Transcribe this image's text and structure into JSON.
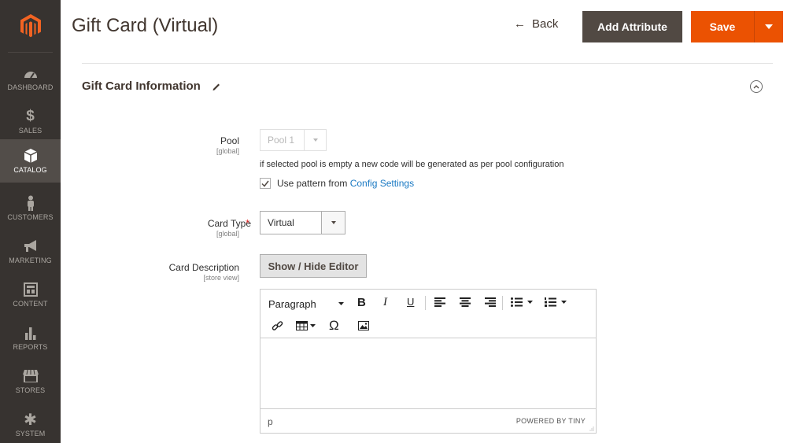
{
  "page": {
    "title": "Gift Card (Virtual)",
    "back_label": "Back",
    "add_attribute_label": "Add Attribute",
    "save_label": "Save"
  },
  "sidebar": {
    "items": [
      {
        "label": "DASHBOARD",
        "icon": "dashboard-icon"
      },
      {
        "label": "SALES",
        "icon": "dollar-icon"
      },
      {
        "label": "CATALOG",
        "icon": "box-icon",
        "active": true
      },
      {
        "label": "CUSTOMERS",
        "icon": "person-icon"
      },
      {
        "label": "MARKETING",
        "icon": "megaphone-icon"
      },
      {
        "label": "CONTENT",
        "icon": "layout-icon"
      },
      {
        "label": "REPORTS",
        "icon": "bar-chart-icon"
      },
      {
        "label": "STORES",
        "icon": "storefront-icon"
      },
      {
        "label": "SYSTEM",
        "icon": "gear-icon"
      }
    ]
  },
  "section": {
    "title": "Gift Card Information"
  },
  "form": {
    "pool": {
      "label": "Pool",
      "scope": "[global]",
      "value": "Pool 1",
      "note": "if selected pool is empty a new code will be generated as per pool configuration",
      "checkbox_label": "Use pattern from ",
      "checkbox_link": "Config Settings",
      "checked": true
    },
    "card_type": {
      "label": "Card Type",
      "scope": "[global]",
      "required_mark": "*",
      "value": "Virtual"
    },
    "card_description": {
      "label": "Card Description",
      "scope": "[store view]",
      "toggle_label": "Show / Hide Editor"
    }
  },
  "editor": {
    "format_value": "Paragraph",
    "bold": "B",
    "italic": "I",
    "underline": "U",
    "omega": "Ω",
    "status_path": "p",
    "powered_by": "POWERED BY TINY"
  },
  "colors": {
    "sidebar_bg": "#373330",
    "sidebar_active": "#524d49",
    "accent_orange": "#eb5202",
    "dark_button": "#514943",
    "link_blue": "#1979c3",
    "required_red": "#e22626"
  }
}
